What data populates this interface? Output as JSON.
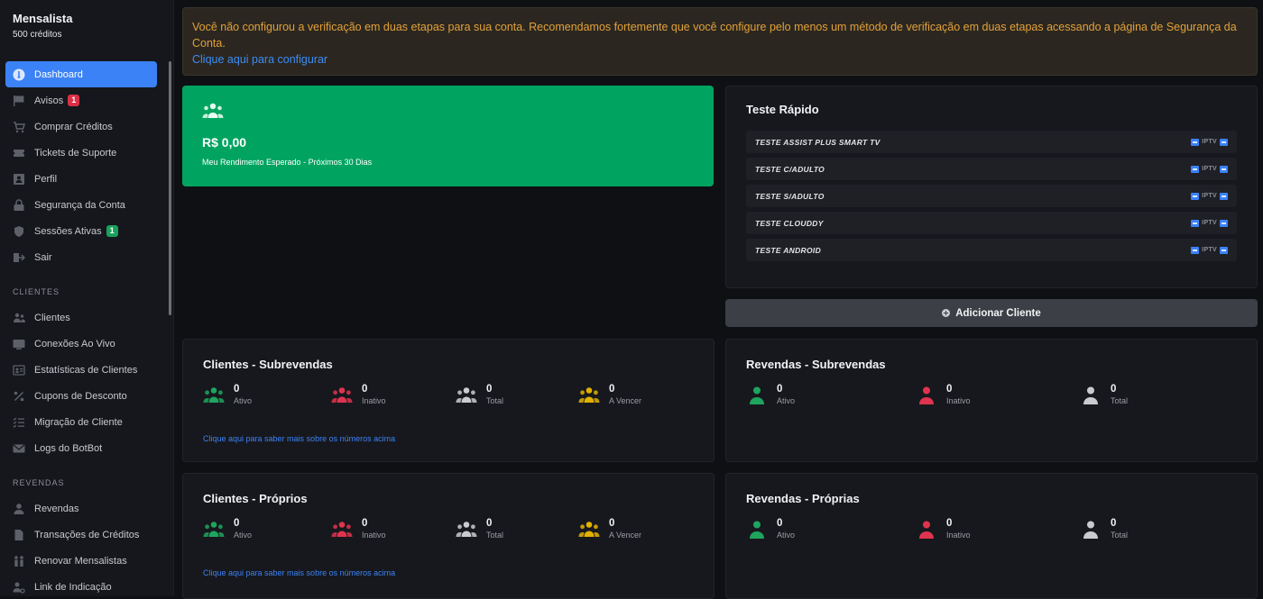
{
  "sidebar": {
    "title": "Mensalista",
    "credits": "500 créditos",
    "items": [
      {
        "label": "Dashboard",
        "icon": "dashboard-icon"
      },
      {
        "label": "Avisos",
        "icon": "flag-icon",
        "badge": "1"
      },
      {
        "label": "Comprar Créditos",
        "icon": "cart-icon"
      },
      {
        "label": "Tickets de Suporte",
        "icon": "ticket-icon"
      },
      {
        "label": "Perfil",
        "icon": "profile-icon"
      },
      {
        "label": "Segurança da Conta",
        "icon": "lock-icon"
      },
      {
        "label": "Sessões Ativas",
        "icon": "shield-icon",
        "badge": "1"
      },
      {
        "label": "Sair",
        "icon": "logout-icon"
      }
    ],
    "section_clients": "CLIENTES",
    "client_items": [
      {
        "label": "Clientes"
      },
      {
        "label": "Conexões Ao Vivo"
      },
      {
        "label": "Estatísticas de Clientes"
      },
      {
        "label": "Cupons de Desconto"
      },
      {
        "label": "Migração de Cliente"
      },
      {
        "label": "Logs do BotBot"
      }
    ],
    "section_resellers": "REVENDAS",
    "reseller_items": [
      {
        "label": "Revendas"
      },
      {
        "label": "Transações de Créditos"
      },
      {
        "label": "Renovar Mensalistas"
      },
      {
        "label": "Link de Indicação"
      }
    ]
  },
  "alert": {
    "text": "Você não configurou a verificação em duas etapas para sua conta. Recomendamos fortemente que você configure pelo menos um método de verificação em duas etapas acessando a página de Segurança da Conta.",
    "link": "Clique aqui para configurar"
  },
  "income": {
    "amount": "R$ 0,00",
    "label": "Meu Rendimento Esperado - Próximos 30 Dias"
  },
  "quick_test": {
    "title": "Teste Rápido",
    "tag": "IPTV",
    "items": [
      "TESTE ASSIST PLUS SMART TV",
      "TESTE C/ADULTO",
      "TESTE S/ADULTO",
      "TESTE CLOUDDY",
      "TESTE ANDROID"
    ]
  },
  "add_client": "Adicionar Cliente",
  "clients_sub": {
    "title": "Clientes - Subrevendas",
    "stats": [
      {
        "value": "0",
        "label": "Ativo"
      },
      {
        "value": "0",
        "label": "Inativo"
      },
      {
        "value": "0",
        "label": "Total"
      },
      {
        "value": "0",
        "label": "A Vencer"
      }
    ],
    "link": "Clique aqui para saber mais sobre os números acima"
  },
  "resellers_sub": {
    "title": "Revendas - Subrevendas",
    "stats": [
      {
        "value": "0",
        "label": "Ativo"
      },
      {
        "value": "0",
        "label": "Inativo"
      },
      {
        "value": "0",
        "label": "Total"
      }
    ]
  },
  "clients_own": {
    "title": "Clientes - Próprios",
    "stats": [
      {
        "value": "0",
        "label": "Ativo"
      },
      {
        "value": "0",
        "label": "Inativo"
      },
      {
        "value": "0",
        "label": "Total"
      },
      {
        "value": "0",
        "label": "A Vencer"
      }
    ],
    "link": "Clique aqui para saber mais sobre os números acima"
  },
  "resellers_own": {
    "title": "Revendas - Próprias",
    "stats": [
      {
        "value": "0",
        "label": "Ativo"
      },
      {
        "value": "0",
        "label": "Inativo"
      },
      {
        "value": "0",
        "label": "Total"
      }
    ]
  },
  "colors": {
    "accent": "#3b82f6",
    "green": "#00a460",
    "active": "#1ea45e",
    "inactive": "#e0334f",
    "total": "#c9cbd1",
    "due": "#e2b100",
    "warning": "#e3a03a"
  }
}
